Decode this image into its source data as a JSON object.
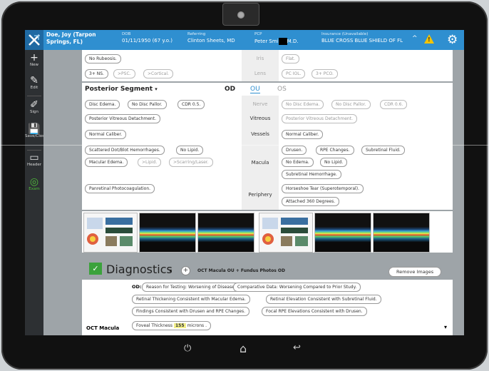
{
  "header": {
    "patient_name": "Doe, Joy (Tarpon Springs, FL)",
    "dob_label": "DOB",
    "dob_value": "01/11/1950 (67 y.o.)",
    "referring_label": "Referring",
    "referring_value": "Clinton Sheets, MD",
    "pcp_label": "PCP",
    "pcp_value_left": "Peter Smi",
    "pcp_value_right": "M.D.",
    "insurance_label": "Insurance (Unavailable)",
    "insurance_value": "BLUE CROSS BLUE SHIELD OF FL",
    "caret": "^",
    "warning_mark": "!",
    "gear_icon": "gear-icon"
  },
  "sidebar": {
    "items": [
      {
        "label": "New",
        "icon": "+"
      },
      {
        "label": "Edit",
        "icon": "✎"
      },
      {
        "label": "Sign",
        "icon": "✐"
      },
      {
        "label": "Save/Close",
        "icon": "💾"
      },
      {
        "label": "Header",
        "icon": "▭"
      },
      {
        "label": "Exam",
        "icon": "◎"
      }
    ]
  },
  "top_rows": {
    "iris_label": "Iris",
    "lens_label": "Lens",
    "od_rubeosis": "No Rubeosis.",
    "od_ns": "3+ NS.",
    "od_psc": ">PSC.",
    "od_cortical": ">Cortical.",
    "os_flat": "Flat.",
    "os_pciol": "PC IOL.",
    "os_pco": "3+ PCO."
  },
  "posterior": {
    "title": "Posterior Segment",
    "caret": "▾",
    "tab_od": "OD",
    "tab_ou": "OU",
    "tab_os": "OS",
    "labels": {
      "nerve": "Nerve",
      "vitreous": "Vitreous",
      "vessels": "Vessels",
      "macula": "Macula",
      "periphery": "Periphery"
    },
    "od": {
      "disc_edema": "Disc Edema.",
      "no_disc_pallor": "No Disc Pallor.",
      "cdr": "CDR 0.5.",
      "pvd": "Posterior Vitreous Detachment.",
      "normal_caliber": "Normal Caliber.",
      "scattered": "Scattered Dot/Blot Hemorrhages.",
      "no_lipid": "No Lipid.",
      "macular_edema": "Macular Edema.",
      "lipid": ">Lipid.",
      "scarring": ">Scarring/Laser.",
      "prp": "Panretinal Photocoagulation."
    },
    "os": {
      "no_disc_edema": "No Disc Edema.",
      "no_disc_pallor": "No Disc Pallor.",
      "cdr": "CDR 0.6.",
      "pvd": "Posterior Vitreous Detachment.",
      "normal_caliber": "Normal Caliber.",
      "drusen": "Drusen.",
      "rpe": "RPE Changes.",
      "subretinal_fluid": "Subretinal Fluid.",
      "no_edema": "No Edema.",
      "no_lipid": "No Lipid.",
      "subretinal_hem": "Subretinal Hemorrhage.",
      "horseshoe": "Horseshoe Tear (Superotemporal).",
      "attached": "Attached 360 Degrees."
    }
  },
  "diagnostics": {
    "check_mark": "✓",
    "title": "Diagnostics",
    "caret": "▾",
    "plus": "+",
    "tag": "OCT Macula OU + Fundus Photos OD",
    "remove_button": "Remove Images",
    "od_label": "OD:",
    "row_label": "OCT Macula",
    "pills": [
      "Reason for Testing: Worsening of Disease.",
      "Comparative Data: Worsening Compared to Prior Study.",
      "Retinal Thickening Consistent with Macular Edema.",
      "Retinal Elevation Consistent with Subretinal Fluid.",
      "Findings Consistent with Drusen and RPE Changes.",
      "Focal RPE Elevations Consistent with Drusen."
    ],
    "foveal_label": "Foveal Thickness",
    "foveal_value": "155",
    "foveal_units": "microns .",
    "dropdown_caret": "▾"
  },
  "navbar": {
    "power_icon": "⏻",
    "home_icon": "⌂",
    "back_icon": "↩"
  }
}
